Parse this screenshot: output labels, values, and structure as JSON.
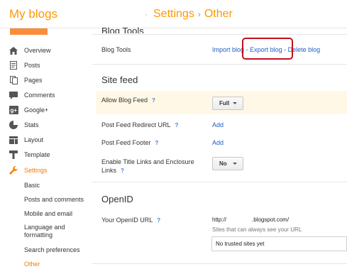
{
  "header": {
    "title": "My blogs",
    "crumb_settings": "Settings",
    "crumb_separator": "›",
    "crumb_current": "Other",
    "accent_color": "#ff9800"
  },
  "sidebar": {
    "items": [
      {
        "label": "Overview",
        "icon": "home-icon"
      },
      {
        "label": "Posts",
        "icon": "posts-icon"
      },
      {
        "label": "Pages",
        "icon": "pages-icon"
      },
      {
        "label": "Comments",
        "icon": "comments-icon"
      },
      {
        "label": "Google+",
        "icon": "google-plus-icon"
      },
      {
        "label": "Stats",
        "icon": "stats-icon"
      },
      {
        "label": "Layout",
        "icon": "layout-icon"
      },
      {
        "label": "Template",
        "icon": "template-icon"
      },
      {
        "label": "Settings",
        "icon": "wrench-icon"
      }
    ],
    "subitems": [
      "Basic",
      "Posts and comments",
      "Mobile and email",
      "Language and formatting",
      "Search preferences",
      "Other"
    ]
  },
  "main": {
    "blog_tools": {
      "label": "Blog Tools",
      "import": "Import blog",
      "export": "Export blog",
      "delete": "Delete blog",
      "sep": "-"
    },
    "site_feed": {
      "title": "Site feed",
      "allow_label": "Allow Blog Feed",
      "allow_value": "Full",
      "redirect_label": "Post Feed Redirect URL",
      "redirect_action": "Add",
      "footer_label": "Post Feed Footer",
      "footer_action": "Add",
      "title_links_label_1": "Enable Title Links and Enclosure",
      "title_links_label_2": "Links",
      "title_links_value": "No",
      "help": "?"
    },
    "openid": {
      "title": "OpenID",
      "url_label": "Your OpenID URL",
      "url_prefix": "http://",
      "url_suffix": ".blogspot.com/",
      "trusted_caption": "Sites that can always see your URL",
      "trusted_value": "No trusted sites yet"
    }
  }
}
